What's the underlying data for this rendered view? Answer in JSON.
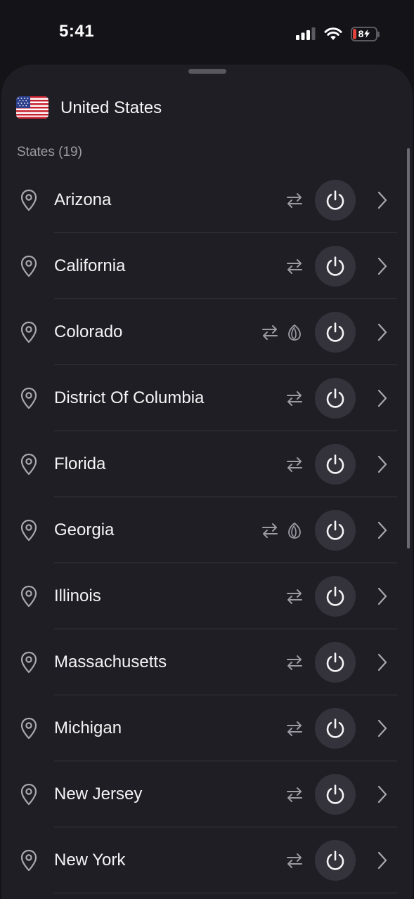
{
  "status_bar": {
    "time": "5:41",
    "battery": "8"
  },
  "country": {
    "name": "United States",
    "flag": "us-flag"
  },
  "section_label": "States (19)",
  "states": [
    {
      "name": "Arizona",
      "onion": false
    },
    {
      "name": "California",
      "onion": false
    },
    {
      "name": "Colorado",
      "onion": true
    },
    {
      "name": "District Of Columbia",
      "onion": false
    },
    {
      "name": "Florida",
      "onion": false
    },
    {
      "name": "Georgia",
      "onion": true
    },
    {
      "name": "Illinois",
      "onion": false
    },
    {
      "name": "Massachusetts",
      "onion": false
    },
    {
      "name": "Michigan",
      "onion": false
    },
    {
      "name": "New Jersey",
      "onion": false
    },
    {
      "name": "New York",
      "onion": false
    }
  ],
  "icons": {
    "location": "location-pin-icon",
    "p2p": "swap-arrows-icon",
    "tor": "onion-icon",
    "connect": "power-icon",
    "details": "chevron-right-icon"
  },
  "colors": {
    "background": "#131318",
    "sheet": "#1f1e24",
    "power_button": "#34333b",
    "battery_low": "#e0433c"
  }
}
